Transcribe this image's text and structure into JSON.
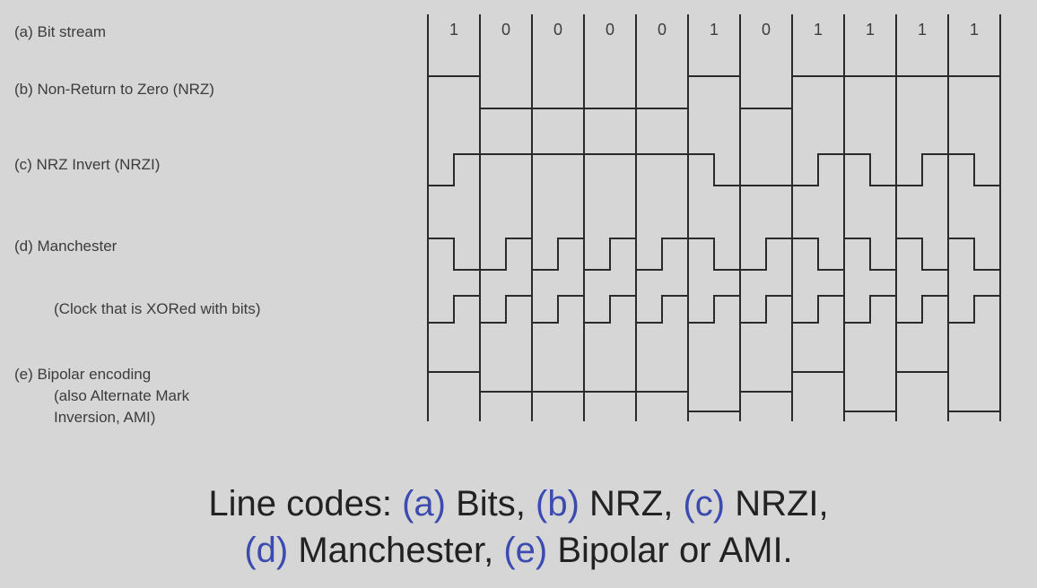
{
  "rows": {
    "a": "(a) Bit stream",
    "b": "(b) Non-Return to Zero (NRZ)",
    "c": "(c) NRZ Invert (NRZI)",
    "d": "(d) Manchester",
    "clock": "(Clock that is XORed with bits)",
    "e1": "(e) Bipolar encoding",
    "e2": "(also Alternate Mark",
    "e3": "Inversion, AMI)"
  },
  "bits": [
    "1",
    "0",
    "0",
    "0",
    "0",
    "1",
    "0",
    "1",
    "1",
    "1",
    "1"
  ],
  "caption": {
    "line1": [
      {
        "text": "Line codes: ",
        "tag": false
      },
      {
        "text": "(a)",
        "tag": true
      },
      {
        "text": " Bits, ",
        "tag": false
      },
      {
        "text": "(b)",
        "tag": true
      },
      {
        "text": " NRZ, ",
        "tag": false
      },
      {
        "text": "(c)",
        "tag": true
      },
      {
        "text": " NRZI,",
        "tag": false
      }
    ],
    "line2": [
      {
        "text": "(d)",
        "tag": true
      },
      {
        "text": " Manchester, ",
        "tag": false
      },
      {
        "text": "(e)",
        "tag": true
      },
      {
        "text": " Bipolar or AMI.",
        "tag": false
      }
    ]
  },
  "colors": {
    "background": "#d6d6d6",
    "line": "#2a2a2a",
    "caption_tag": "#3b4bb0"
  }
}
